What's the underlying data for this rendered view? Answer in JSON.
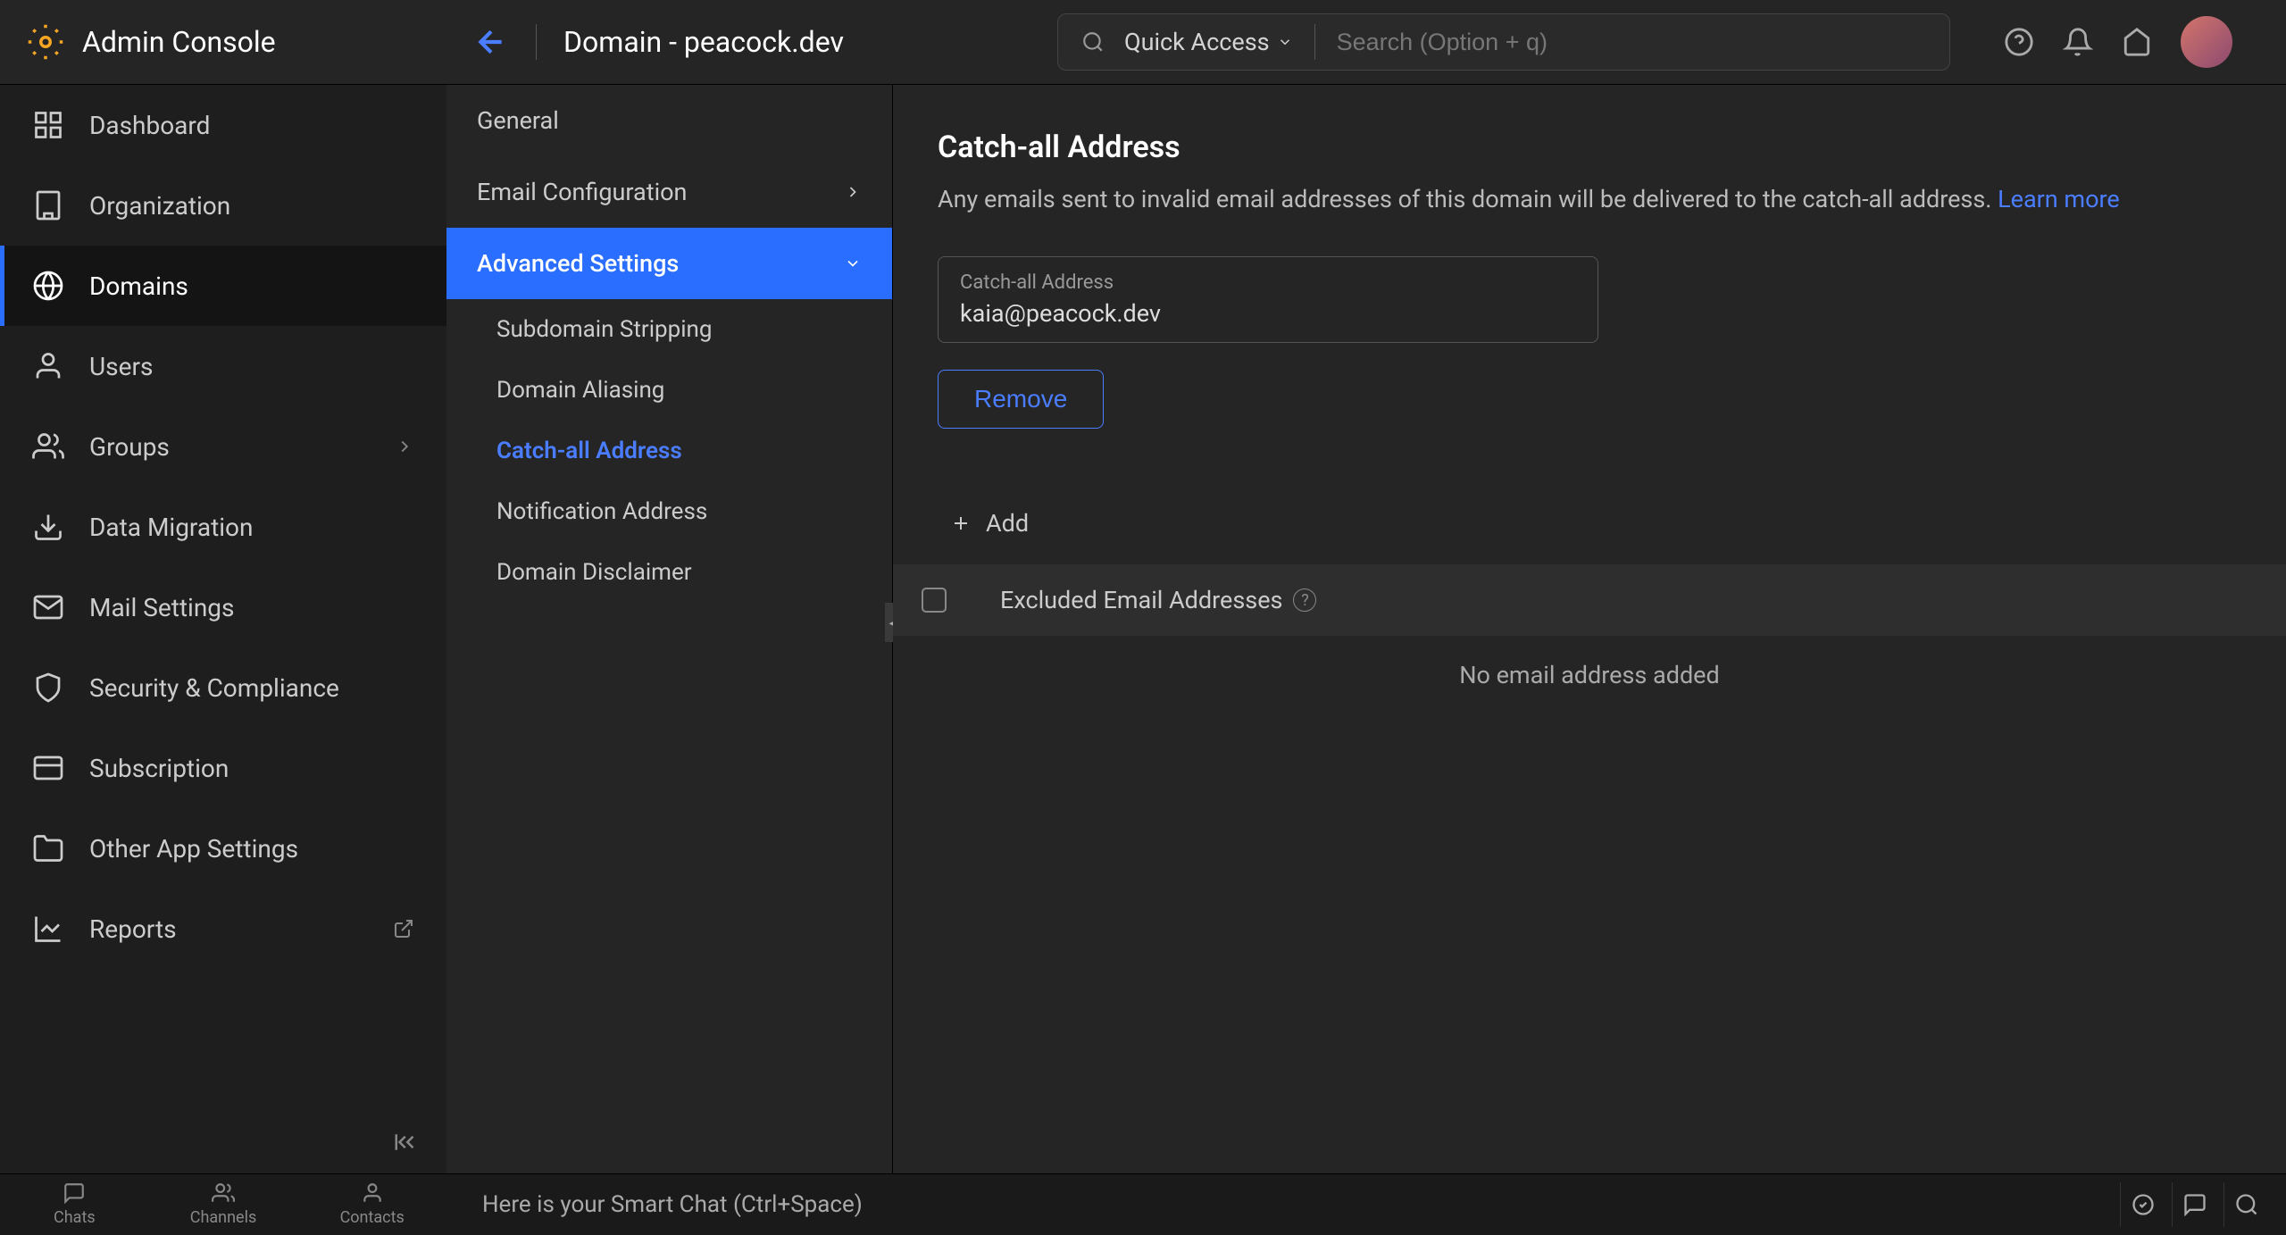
{
  "brand": "Admin Console",
  "page_title": "Domain - peacock.dev",
  "quick_access": "Quick Access",
  "search_placeholder": "Search (Option + q)",
  "nav": [
    {
      "label": "Dashboard",
      "icon": "dashboard"
    },
    {
      "label": "Organization",
      "icon": "building"
    },
    {
      "label": "Domains",
      "icon": "globe",
      "active": true
    },
    {
      "label": "Users",
      "icon": "user"
    },
    {
      "label": "Groups",
      "icon": "users",
      "chevron": true
    },
    {
      "label": "Data Migration",
      "icon": "download"
    },
    {
      "label": "Mail Settings",
      "icon": "mail"
    },
    {
      "label": "Security & Compliance",
      "icon": "shield"
    },
    {
      "label": "Subscription",
      "icon": "card"
    },
    {
      "label": "Other App Settings",
      "icon": "folder"
    },
    {
      "label": "Reports",
      "icon": "chart",
      "external": true
    }
  ],
  "subnav": {
    "items": [
      {
        "label": "General"
      },
      {
        "label": "Email Configuration",
        "chevron": "right"
      },
      {
        "label": "Advanced Settings",
        "chevron": "down",
        "active": true
      }
    ],
    "sub_items": [
      {
        "label": "Subdomain Stripping"
      },
      {
        "label": "Domain Aliasing"
      },
      {
        "label": "Catch-all Address",
        "selected": true
      },
      {
        "label": "Notification Address"
      },
      {
        "label": "Domain Disclaimer"
      }
    ]
  },
  "content": {
    "title": "Catch-all Address",
    "description": "Any emails sent to invalid email addresses of this domain will be delivered to the catch-all address. ",
    "learn_more": "Learn more",
    "field_label": "Catch-all Address",
    "field_value": "kaia@peacock.dev",
    "remove": "Remove",
    "add": "Add",
    "excluded_title": "Excluded Email Addresses",
    "empty": "No email address added"
  },
  "bottom": {
    "tabs": [
      "Chats",
      "Channels",
      "Contacts"
    ],
    "smart_chat": "Here is your Smart Chat (Ctrl+Space)"
  }
}
